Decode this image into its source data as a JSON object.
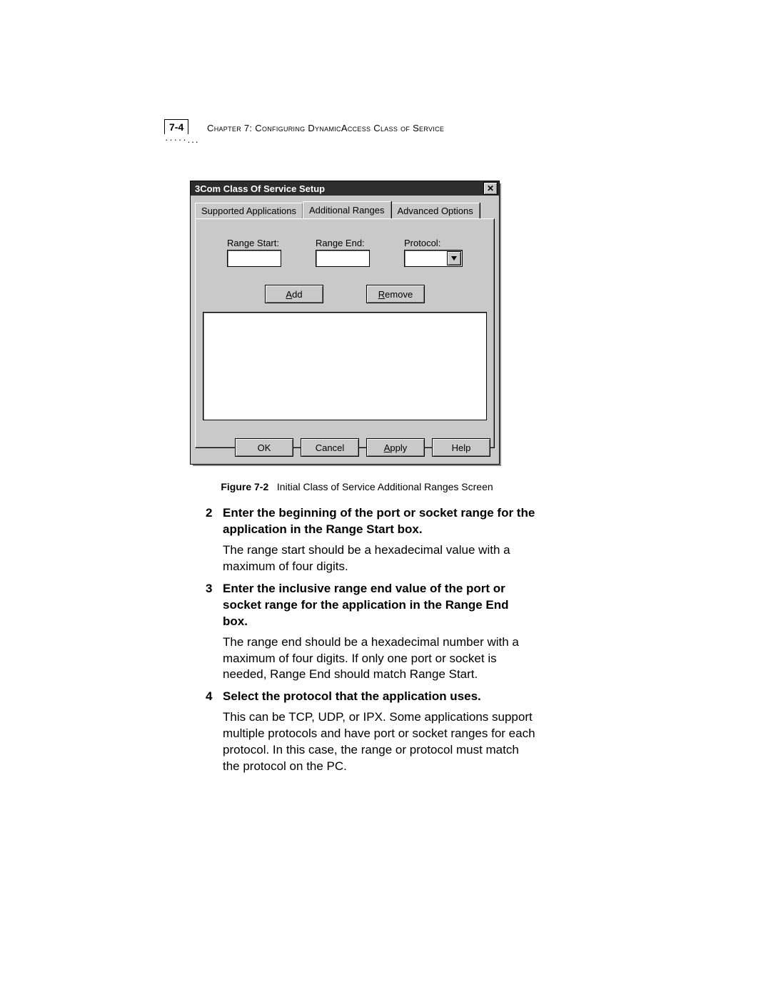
{
  "header": {
    "page_number": "7-4",
    "chapter_line_prefix": "Chapter 7: Configuring Dynamic",
    "chapter_line_suffix": "Access Class of Service"
  },
  "dialog": {
    "title": "3Com Class Of Service Setup",
    "tabs": {
      "supported": "Supported Applications",
      "additional": "Additional Ranges",
      "advanced": "Advanced Options"
    },
    "fields": {
      "range_start_label": "Range Start:",
      "range_end_label": "Range End:",
      "protocol_label": "Protocol:"
    },
    "buttons": {
      "add_u": "A",
      "add_rest": "dd",
      "remove_u": "R",
      "remove_rest": "emove",
      "ok": "OK",
      "cancel": "Cancel",
      "apply_u": "A",
      "apply_rest": "pply",
      "help": "Help"
    }
  },
  "caption": {
    "label": "Figure 7-2",
    "text": "Initial Class of Service Additional Ranges Screen"
  },
  "steps": [
    {
      "num": "2",
      "head": "Enter the beginning of the port or socket range for the application in the Range Start box.",
      "body": "The range start should be a hexadecimal value with a maximum of four digits."
    },
    {
      "num": "3",
      "head": "Enter the inclusive range end value of the port or socket range for the application in the Range End box.",
      "body": "The range end should be a hexadecimal number with a maximum of four digits. If only one port or socket is needed, Range End should match Range Start."
    },
    {
      "num": "4",
      "head": "Select the protocol that the application uses.",
      "body": "This can be TCP, UDP, or IPX. Some applications support multiple protocols and have port or socket ranges for each protocol. In this case, the range or protocol must match the protocol on the PC."
    }
  ]
}
